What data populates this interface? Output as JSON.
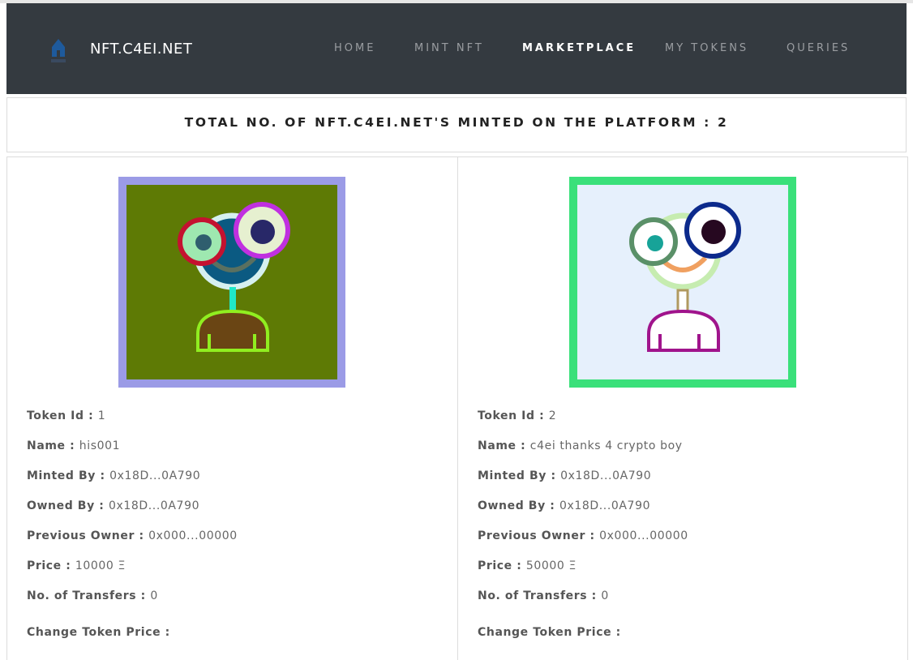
{
  "nav": {
    "brand": "NFT.C4EI.NET",
    "icon": "home-icon",
    "items": [
      {
        "label": "HOME",
        "active": false
      },
      {
        "label": "MINT NFT",
        "active": false
      },
      {
        "label": "MARKETPLACE",
        "active": true
      },
      {
        "label": "MY TOKENS",
        "active": false
      },
      {
        "label": "QUERIES",
        "active": false
      }
    ]
  },
  "total": {
    "text": "TOTAL NO. OF NFT.C4EI.NET'S MINTED ON THE PLATFORM : 2"
  },
  "tokens": [
    {
      "token_id_label": "Token Id : ",
      "token_id": "1",
      "name_label": "Name : ",
      "name": "his001",
      "minted_by_label": "Minted By : ",
      "minted_by": "0x18D...0A790",
      "owned_by_label": "Owned By : ",
      "owned_by": "0x18D...0A790",
      "previous_owner_label": "Previous Owner : ",
      "previous_owner": "0x000...00000",
      "price_label": "Price : ",
      "price": "10000 Ξ",
      "transfers_label": "No. of Transfers : ",
      "transfers": "0",
      "change_price_label": "Change Token Price :",
      "colors": {
        "border": "#9b9be6",
        "bg": "#5e7a05",
        "head": "#0b5a82",
        "headRing": "#d6f0f0",
        "mouth": "#5a7060",
        "eyeL": "#9ee8b0",
        "eyeLRing": "#c41230",
        "pupilL": "#2f5e6e",
        "eyeR": "#e6f0d0",
        "eyeRRing": "#c030e0",
        "pupilR": "#282868",
        "neck": "#20e8c8",
        "body": "#6a4514",
        "bodyStroke": "#90ee20"
      }
    },
    {
      "token_id_label": "Token Id : ",
      "token_id": "2",
      "name_label": "Name : ",
      "name": "c4ei thanks 4 crypto boy",
      "minted_by_label": "Minted By : ",
      "minted_by": "0x18D...0A790",
      "owned_by_label": "Owned By : ",
      "owned_by": "0x18D...0A790",
      "previous_owner_label": "Previous Owner : ",
      "previous_owner": "0x000...00000",
      "price_label": "Price : ",
      "price": "50000 Ξ",
      "transfers_label": "No. of Transfers : ",
      "transfers": "0",
      "change_price_label": "Change Token Price :",
      "colors": {
        "border": "#3ae07a",
        "bg": "#e6f0fc",
        "head": "#ffffff",
        "headRing": "#c6ecb0",
        "mouth": "#f0a060",
        "eyeL": "#ffffff",
        "eyeLRing": "#5a9068",
        "pupilL": "#17a398",
        "eyeR": "#ffffff",
        "eyeRRing": "#0c2a8c",
        "pupilR": "#260820",
        "neck": "#ffffff",
        "neckStroke": "#b09a60",
        "body": "#ffffff",
        "bodyStroke": "#a0148c"
      }
    }
  ]
}
